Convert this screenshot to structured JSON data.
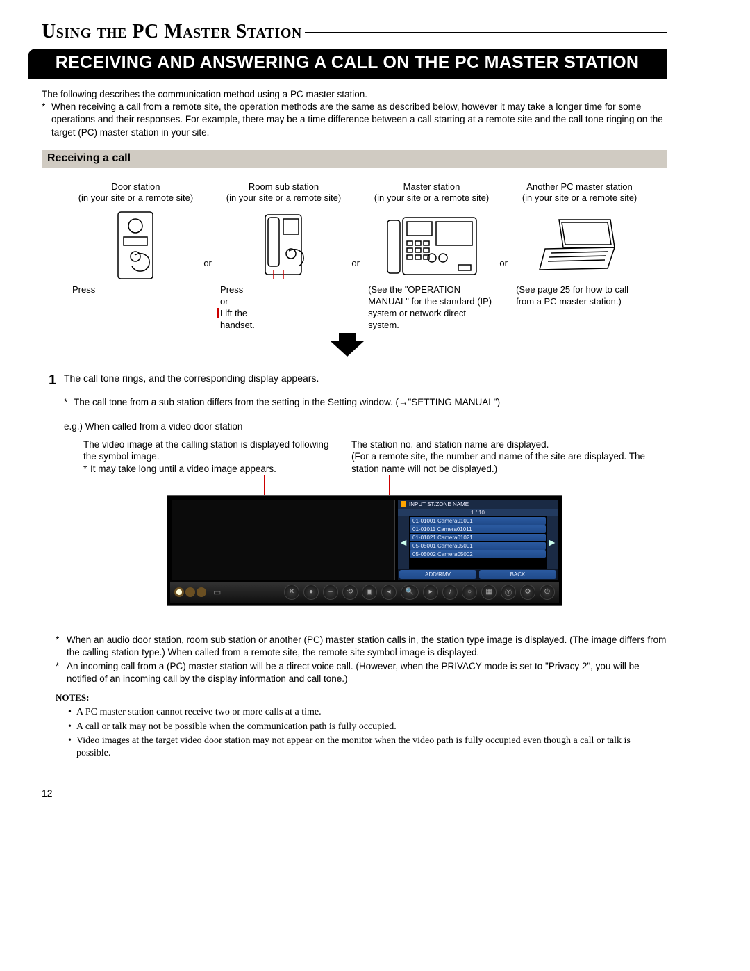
{
  "page": {
    "title": "Using the PC Master Station",
    "bar": "RECEIVING AND ANSWERING A CALL ON THE PC MASTER STATION",
    "intro1": "The following describes the communication method using a PC master station.",
    "intro2": "When receiving a call from a remote site, the operation methods are the same as described below, however it may take a longer time for some operations and their responses. For example, there may be a time difference between a call starting at a remote site and the call tone ringing on the target (PC) master station in your site.",
    "subheading": "Receiving a call",
    "page_number": "12"
  },
  "stations": {
    "door": {
      "name": "Door station",
      "sub": "(in your site or a remote site)",
      "action": "Press"
    },
    "room": {
      "name": "Room sub station",
      "sub": "(in your site or a remote site)",
      "action1": "Press",
      "action2": "or",
      "action3": "Lift the",
      "action4": "handset."
    },
    "master": {
      "name": "Master station",
      "sub": "(in your site or a remote site)",
      "action": "(See the \"OPERATION MANUAL\" for the standard (IP) system or network direct system."
    },
    "pc": {
      "name": "Another PC master station",
      "sub": "(in your site or a remote site)",
      "action": "(See page 25 for how to call from a PC master station.)"
    },
    "or": "or"
  },
  "step1": {
    "num": "1",
    "text": "The call tone rings, and the corresponding display appears.",
    "subnote": "The call tone from a sub station differs from the setting in the Setting window. (→\"SETTING MANUAL\")",
    "eg": "e.g.) When called from a video door station"
  },
  "callouts": {
    "left1": "The video image at the calling station is displayed following the symbol image.",
    "left2": "It may take long until a video image appears.",
    "right1": "The station no. and station name are displayed.",
    "right2": "(For a remote site, the number and name of the site are displayed. The station name will not be displayed.)"
  },
  "ui": {
    "header": "INPUT ST/ZONE NAME",
    "page_indicator": "1 / 10",
    "items": [
      "01-01001  Camera01001",
      "01-01011  Camera01011",
      "01-01021  Camera01021",
      "05-05001  Camera05001",
      "05-05002  Camera05002"
    ],
    "btn_left": "ADD/RMV",
    "btn_right": "BACK"
  },
  "post_notes": {
    "n1": "When an audio door station, room sub station or another (PC) master station calls in, the station type image is displayed. (The image differs from the calling station type.) When called from a remote site, the remote site symbol image is displayed.",
    "n2": "An incoming call from a (PC) master station will be a direct voice call. (However, when the PRIVACY mode is set to \"Privacy 2\", you will be notified of an incoming call by the display information and call tone.)"
  },
  "notes": {
    "heading": "NOTES:",
    "items": [
      "A PC master station cannot receive two or more calls at a time.",
      "A call or talk may not be possible when the communication path is fully occupied.",
      "Video images at the target video door station may not appear on the monitor when the video path is fully occupied even though a call or talk is possible."
    ]
  }
}
